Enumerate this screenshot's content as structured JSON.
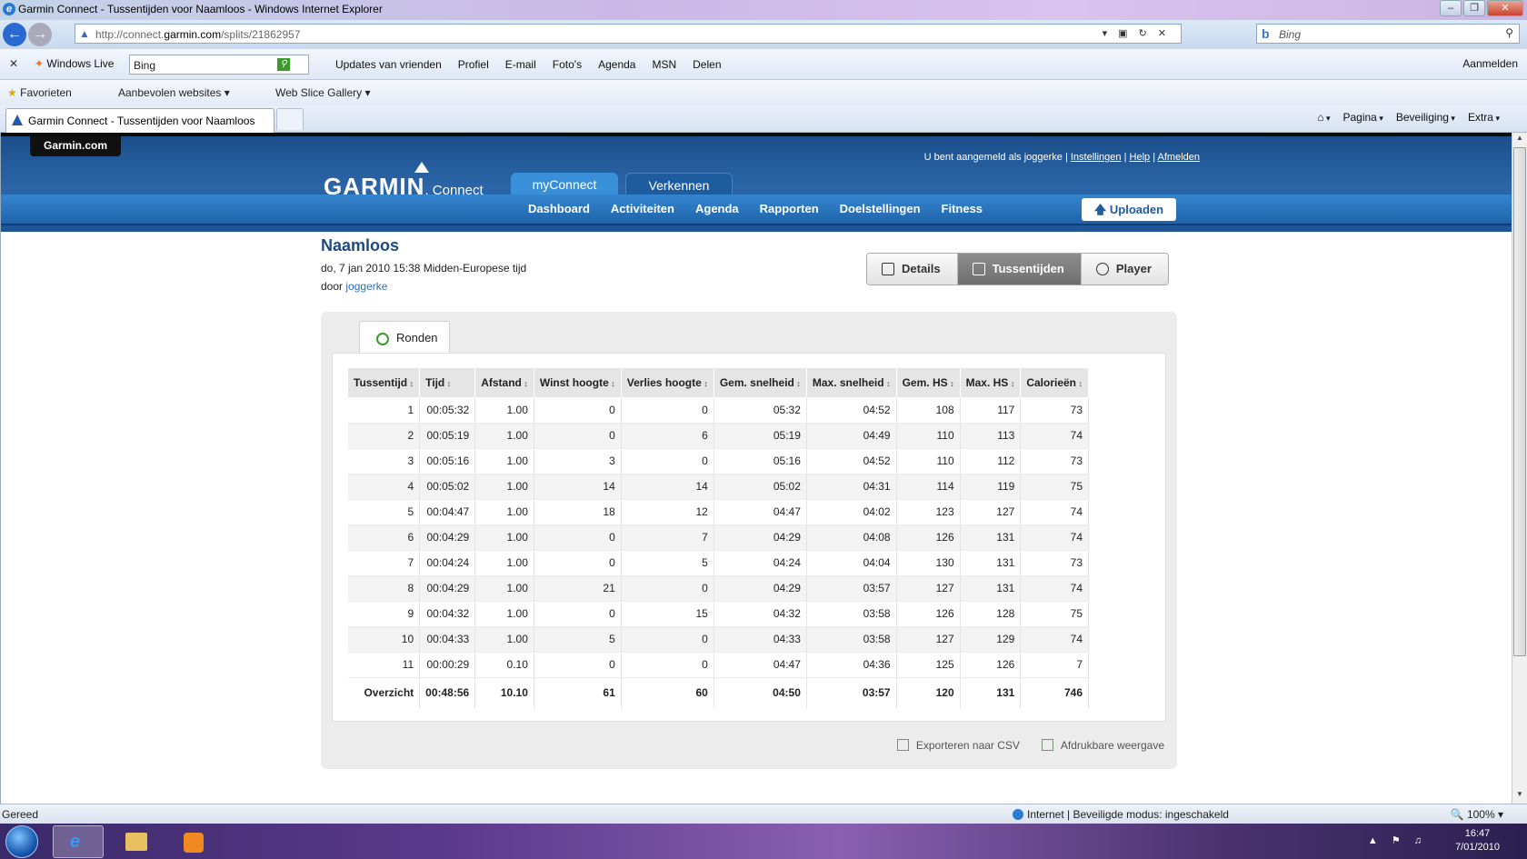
{
  "window": {
    "title": "Garmin Connect - Tussentijden voor Naamloos - Windows Internet Explorer"
  },
  "address": {
    "url_prefix": "http://connect.",
    "url_domain": "garmin.com",
    "url_path": "/splits/21862957"
  },
  "search": {
    "placeholder": "Bing"
  },
  "live_bar": {
    "brand": "Windows Live",
    "search_value": "Bing",
    "menu": [
      "Updates van vrienden",
      "Profiel",
      "E-mail",
      "Foto's",
      "Agenda",
      "MSN",
      "Delen"
    ],
    "signin": "Aanmelden"
  },
  "favorites": {
    "label": "Favorieten",
    "items": [
      "Aanbevolen websites",
      "Web Slice Gallery"
    ]
  },
  "tab": {
    "title": "Garmin Connect - Tussentijden voor Naamloos"
  },
  "command_bar": [
    "Pagina",
    "Beveiliging",
    "Extra"
  ],
  "site": {
    "garmin_com": "Garmin.com",
    "logo": "GARMIN",
    "logo_sub": "Connect",
    "user_text": "U bent aangemeld als joggerke |",
    "links": [
      "Instellingen",
      "Help",
      "Afmelden"
    ],
    "tabs": [
      "myConnect",
      "Verkennen"
    ],
    "nav": [
      "Dashboard",
      "Activiteiten",
      "Agenda",
      "Rapporten",
      "Doelstellingen",
      "Fitness"
    ],
    "upload": "Uploaden"
  },
  "activity": {
    "name": "Naamloos",
    "date": "do, 7 jan 2010 15:38 Midden-Europese tijd",
    "by_prefix": "door",
    "by_user": "joggerke",
    "view_tabs": [
      "Details",
      "Tussentijden",
      "Player"
    ],
    "active_view": "Tussentijden",
    "subtab": "Ronden"
  },
  "splits": {
    "columns": [
      "Tussentijd",
      "Tijd",
      "Afstand",
      "Winst hoogte",
      "Verlies hoogte",
      "Gem. snelheid",
      "Max. snelheid",
      "Gem. HS",
      "Max. HS",
      "Calorieën"
    ],
    "rows": [
      [
        "1",
        "00:05:32",
        "1.00",
        "0",
        "0",
        "05:32",
        "04:52",
        "108",
        "117",
        "73"
      ],
      [
        "2",
        "00:05:19",
        "1.00",
        "0",
        "6",
        "05:19",
        "04:49",
        "110",
        "113",
        "74"
      ],
      [
        "3",
        "00:05:16",
        "1.00",
        "3",
        "0",
        "05:16",
        "04:52",
        "110",
        "112",
        "73"
      ],
      [
        "4",
        "00:05:02",
        "1.00",
        "14",
        "14",
        "05:02",
        "04:31",
        "114",
        "119",
        "75"
      ],
      [
        "5",
        "00:04:47",
        "1.00",
        "18",
        "12",
        "04:47",
        "04:02",
        "123",
        "127",
        "74"
      ],
      [
        "6",
        "00:04:29",
        "1.00",
        "0",
        "7",
        "04:29",
        "04:08",
        "126",
        "131",
        "74"
      ],
      [
        "7",
        "00:04:24",
        "1.00",
        "0",
        "5",
        "04:24",
        "04:04",
        "130",
        "131",
        "73"
      ],
      [
        "8",
        "00:04:29",
        "1.00",
        "21",
        "0",
        "04:29",
        "03:57",
        "127",
        "131",
        "74"
      ],
      [
        "9",
        "00:04:32",
        "1.00",
        "0",
        "15",
        "04:32",
        "03:58",
        "126",
        "128",
        "75"
      ],
      [
        "10",
        "00:04:33",
        "1.00",
        "5",
        "0",
        "04:33",
        "03:58",
        "127",
        "129",
        "74"
      ],
      [
        "11",
        "00:00:29",
        "0.10",
        "0",
        "0",
        "04:47",
        "04:36",
        "125",
        "126",
        "7"
      ]
    ],
    "total": [
      "Overzicht",
      "00:48:56",
      "10.10",
      "61",
      "60",
      "04:50",
      "03:57",
      "120",
      "131",
      "746"
    ]
  },
  "footer_links": {
    "csv": "Exporteren naar CSV",
    "print": "Afdrukbare weergave"
  },
  "status": {
    "left": "Gereed",
    "zone": "Internet | Beveiligde modus: ingeschakeld",
    "zoom": "100%"
  },
  "taskbar": {
    "time": "16:47",
    "date": "7/01/2010"
  }
}
